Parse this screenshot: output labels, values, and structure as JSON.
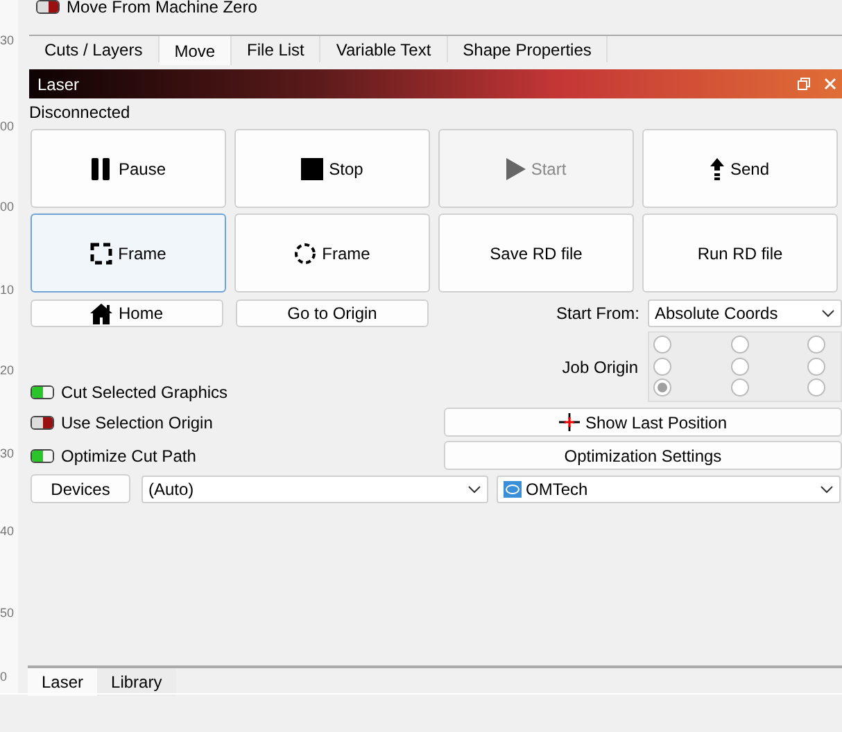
{
  "ruler": {
    "labels": [
      "30",
      "00",
      "00",
      "10",
      "20",
      "30",
      "40",
      "50",
      "0"
    ]
  },
  "top_toggle": {
    "label": "Move From Machine Zero",
    "on": false
  },
  "tabs": [
    {
      "label": "Cuts / Layers",
      "selected": false
    },
    {
      "label": "Move",
      "selected": true
    },
    {
      "label": "File List",
      "selected": false
    },
    {
      "label": "Variable Text",
      "selected": false
    },
    {
      "label": "Shape Properties",
      "selected": false
    }
  ],
  "panel": {
    "title": "Laser",
    "status": "Disconnected",
    "buttons": [
      {
        "label": "Pause",
        "kind": "pause",
        "disabled": false,
        "focused": false
      },
      {
        "label": "Stop",
        "kind": "stop",
        "disabled": false,
        "focused": false
      },
      {
        "label": "Start",
        "kind": "play",
        "disabled": true,
        "focused": false
      },
      {
        "label": "Send",
        "kind": "send",
        "disabled": false,
        "focused": false
      },
      {
        "label": "Frame",
        "kind": "rect-frame",
        "disabled": false,
        "focused": true
      },
      {
        "label": "Frame",
        "kind": "circle-frame",
        "disabled": false,
        "focused": false
      },
      {
        "label": "Save RD file",
        "kind": "text",
        "disabled": false,
        "focused": false
      },
      {
        "label": "Run RD file",
        "kind": "text",
        "disabled": false,
        "focused": false
      }
    ],
    "home_button": "Home",
    "origin_button": "Go to Origin",
    "start_from": {
      "label": "Start From:",
      "value": "Absolute Coords"
    },
    "job_origin": {
      "label": "Job Origin",
      "points": [
        {
          "selected": false
        },
        {
          "selected": false
        },
        {
          "selected": false
        },
        {
          "selected": false
        },
        {
          "selected": false
        },
        {
          "selected": false
        },
        {
          "selected": true
        },
        {
          "selected": false
        },
        {
          "selected": false
        }
      ]
    },
    "toggles": [
      {
        "label": "Cut Selected Graphics",
        "on": true
      },
      {
        "label": "Use Selection Origin",
        "on": false
      },
      {
        "label": "Optimize Cut Path",
        "on": true
      }
    ],
    "show_last_position": "Show Last Position",
    "optimization_settings": "Optimization Settings",
    "devices_button": "Devices",
    "port": {
      "value": "(Auto)"
    },
    "device": {
      "value": "OMTech"
    }
  },
  "bottom_tabs": [
    {
      "label": "Laser",
      "selected": true
    },
    {
      "label": "Library",
      "selected": false
    }
  ]
}
